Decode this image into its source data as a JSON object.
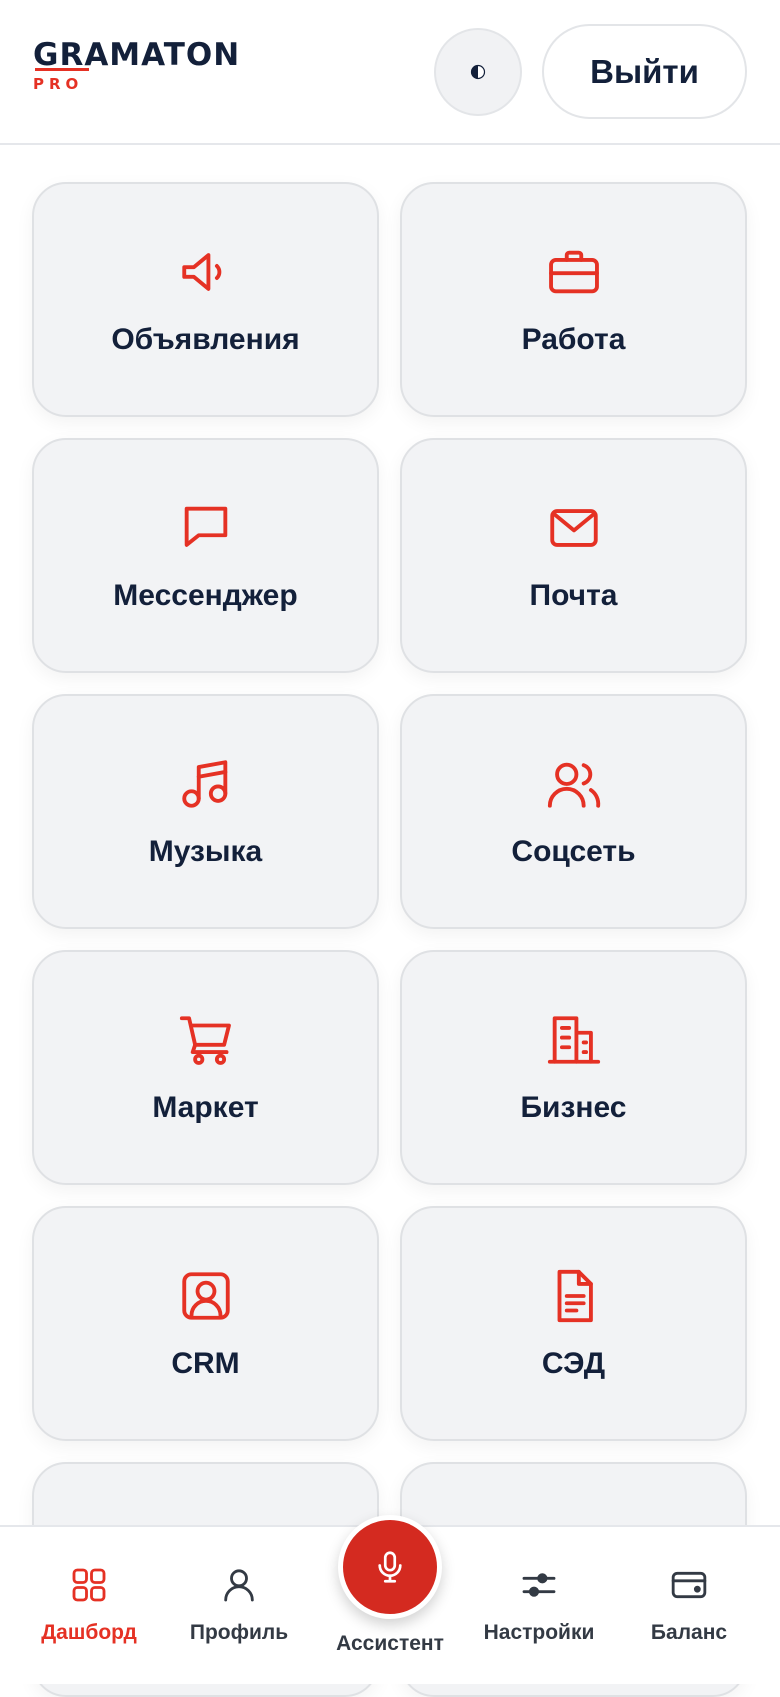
{
  "header": {
    "logo_main": "GRAMATON",
    "logo_sub": "PRO",
    "logout_label": "Выйти",
    "theme_icon": "half-circle-icon"
  },
  "tiles": [
    {
      "label": "Объявления",
      "icon": "megaphone-icon"
    },
    {
      "label": "Работа",
      "icon": "briefcase-icon"
    },
    {
      "label": "Мессенджер",
      "icon": "chat-bubble-icon"
    },
    {
      "label": "Почта",
      "icon": "mail-icon"
    },
    {
      "label": "Музыка",
      "icon": "music-note-icon"
    },
    {
      "label": "Соцсеть",
      "icon": "users-icon"
    },
    {
      "label": "Маркет",
      "icon": "shopping-cart-icon"
    },
    {
      "label": "Бизнес",
      "icon": "buildings-icon"
    },
    {
      "label": "CRM",
      "icon": "contact-card-icon"
    },
    {
      "label": "СЭД",
      "icon": "document-icon"
    },
    {
      "label": "",
      "icon": ""
    },
    {
      "label": "",
      "icon": ""
    }
  ],
  "bottom_nav": {
    "items": [
      {
        "label": "Дашборд",
        "icon": "grid-icon",
        "active": true
      },
      {
        "label": "Профиль",
        "icon": "user-icon",
        "active": false
      },
      {
        "label": "Ассистент",
        "icon": "microphone-icon",
        "active": false
      },
      {
        "label": "Настройки",
        "icon": "sliders-icon",
        "active": false
      },
      {
        "label": "Баланс",
        "icon": "wallet-icon",
        "active": false
      }
    ]
  },
  "colors": {
    "accent": "#e53124",
    "mic_button": "#d42a20",
    "text_dark": "#13203a",
    "tile_bg": "#f2f3f5"
  }
}
